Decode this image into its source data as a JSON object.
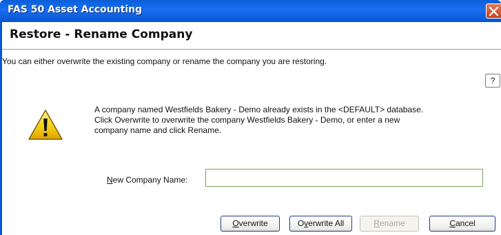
{
  "window": {
    "title": "FAS 50 Asset Accounting"
  },
  "dialog": {
    "heading": "Restore - Rename Company",
    "subtitle": "You can either overwrite the existing company or rename the company you are restoring.",
    "help_label": "?",
    "message_lines": [
      "A company named Westfields Bakery - Demo already exists in the <DEFAULT> database.",
      "Click Overwrite to overwrite the company Westfields Bakery - Demo, or enter a new",
      "company name and click Rename."
    ],
    "new_name_label_key": "N",
    "new_name_label_rest": "ew Company Name:",
    "new_name_value": "",
    "new_name_placeholder": ""
  },
  "buttons": {
    "overwrite": {
      "key": "O",
      "rest": "verwrite",
      "enabled": true
    },
    "overwrite_all": {
      "pre": "O",
      "key": "v",
      "rest": "erwrite All",
      "enabled": true
    },
    "rename": {
      "key": "R",
      "rest": "ename",
      "enabled": false
    },
    "cancel": {
      "key": "C",
      "rest": "ancel",
      "enabled": true
    }
  },
  "icons": {
    "close": "close-icon",
    "warning": "warning-icon"
  },
  "colors": {
    "titlebar": "#0a5fd8",
    "close_button": "#c4401c",
    "warning_yellow": "#f7d61c"
  }
}
